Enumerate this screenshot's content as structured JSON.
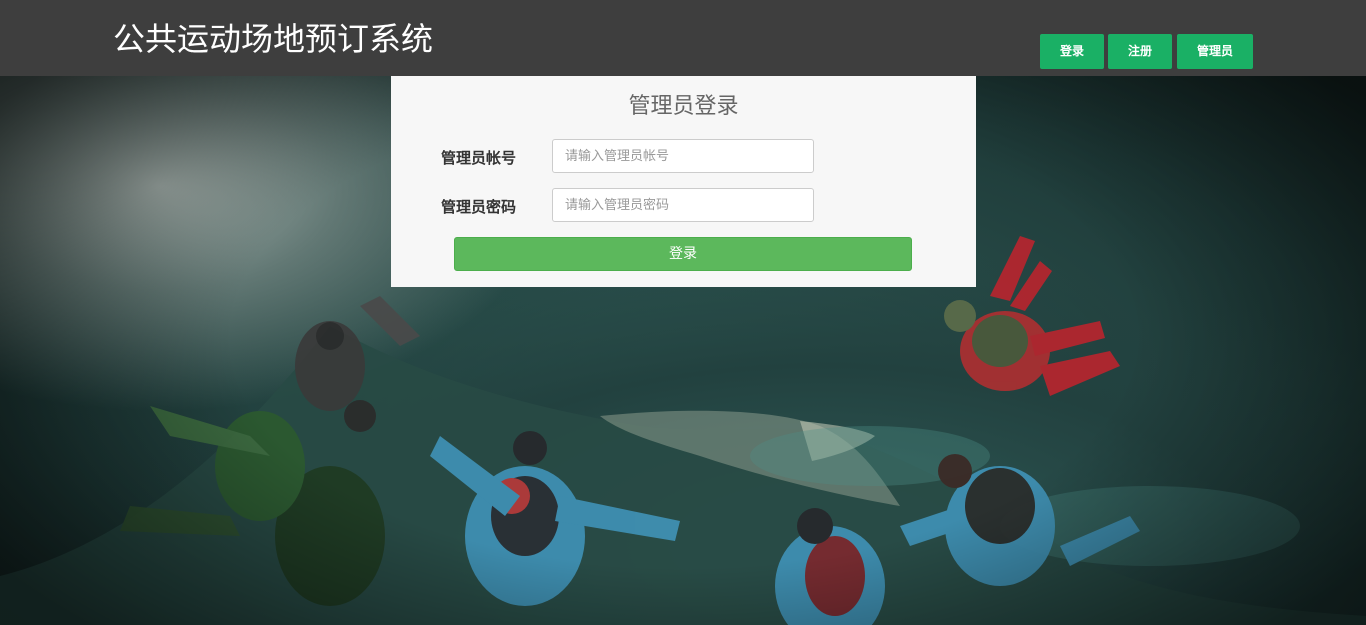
{
  "header": {
    "title": "公共运动场地预订系统",
    "nav": {
      "login_label": "登录",
      "register_label": "注册",
      "admin_label": "管理员"
    }
  },
  "login_panel": {
    "title": "管理员登录",
    "account": {
      "label": "管理员帐号",
      "placeholder": "请输入管理员帐号",
      "value": ""
    },
    "password": {
      "label": "管理员密码",
      "placeholder": "请输入管理员密码",
      "value": ""
    },
    "submit_label": "登录"
  },
  "background": {
    "image_subject": "skydivers-formation-over-coastline"
  },
  "colors": {
    "header_bg": "#3e3e3e",
    "nav_button": "#1ab065",
    "submit_button": "#5cb85c",
    "panel_bg": "#f7f7f7"
  }
}
